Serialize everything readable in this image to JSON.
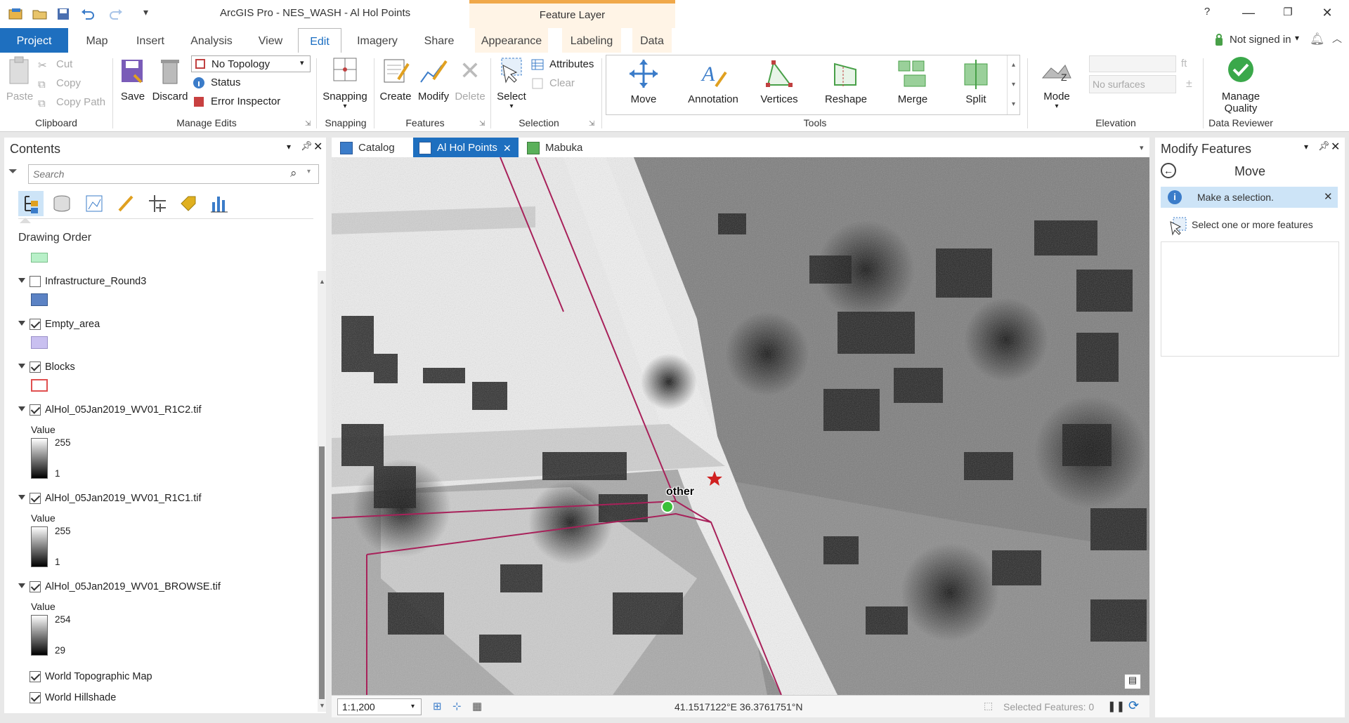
{
  "titlebar": {
    "title": "ArcGIS Pro - NES_WASH - Al Hol Points",
    "context_group": "Feature Layer",
    "help": "?"
  },
  "tabs": [
    "Project",
    "Map",
    "Insert",
    "Analysis",
    "View",
    "Edit",
    "Imagery",
    "Share",
    "Appearance",
    "Labeling",
    "Data"
  ],
  "account": {
    "label": "Not signed in"
  },
  "ribbon": {
    "clipboard": {
      "paste": "Paste",
      "cut": "Cut",
      "copy": "Copy",
      "copy_path": "Copy Path",
      "group": "Clipboard"
    },
    "manage_edits": {
      "save": "Save",
      "discard": "Discard",
      "topology": "No Topology",
      "status": "Status",
      "error_inspector": "Error Inspector",
      "group": "Manage Edits"
    },
    "snapping": {
      "label": "Snapping",
      "group": "Snapping"
    },
    "features": {
      "create": "Create",
      "modify": "Modify",
      "delete": "Delete",
      "group": "Features"
    },
    "selection": {
      "select": "Select",
      "attributes": "Attributes",
      "clear": "Clear",
      "group": "Selection"
    },
    "tools": {
      "items": [
        "Move",
        "Annotation",
        "Vertices",
        "Reshape",
        "Merge",
        "Split"
      ],
      "group": "Tools"
    },
    "elevation": {
      "mode": "Mode",
      "unit": "ft",
      "surface": "No surfaces",
      "group": "Elevation"
    },
    "data_reviewer": {
      "label1": "Manage",
      "label2": "Quality",
      "group": "Data Reviewer"
    }
  },
  "contents": {
    "title": "Contents",
    "search_placeholder": "Search",
    "section": "Drawing Order",
    "layers": [
      {
        "name": "Infrastructure_Round3",
        "checked": false
      },
      {
        "name": "Empty_area",
        "checked": true
      },
      {
        "name": "Blocks",
        "checked": true
      },
      {
        "name": "AlHol_05Jan2019_WV01_R1C2.tif",
        "checked": true,
        "legend_title": "Value",
        "max": "255",
        "min": "1"
      },
      {
        "name": "AlHol_05Jan2019_WV01_R1C1.tif",
        "checked": true,
        "legend_title": "Value",
        "max": "255",
        "min": "1"
      },
      {
        "name": "AlHol_05Jan2019_WV01_BROWSE.tif",
        "checked": true,
        "legend_title": "Value",
        "max": "254",
        "min": "29"
      },
      {
        "name": "World Topographic Map",
        "checked": true
      },
      {
        "name": "World Hillshade",
        "checked": true
      }
    ],
    "swatch_colors": [
      "#b8f0c8",
      "#5b82c4",
      "#c9c0f0",
      "#ffffff"
    ]
  },
  "doc_tabs": [
    "Catalog",
    "Al Hol Points",
    "Mabuka"
  ],
  "map": {
    "label": "other",
    "scale": "1:1,200",
    "coords": "41.1517122°E 36.3761751°N",
    "selected": "Selected Features: 0"
  },
  "modify": {
    "title": "Modify Features",
    "tool": "Move",
    "info": "Make a selection.",
    "hint": "Select one or more features"
  }
}
